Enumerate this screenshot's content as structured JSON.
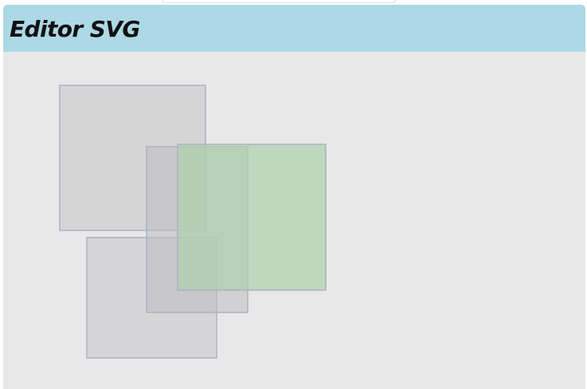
{
  "editor": {
    "title": "Editor SVG"
  },
  "colors": {
    "header_background": "#add8e6",
    "canvas_background": "#e8e8e9",
    "shape_fill_gray": "#cfcfd1",
    "shape_fill_green": "#acd1ac",
    "shape_stroke": "#aeb0c6"
  }
}
